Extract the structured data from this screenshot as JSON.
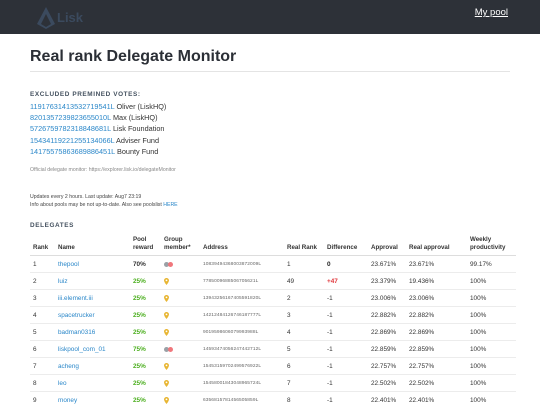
{
  "header": {
    "logo_text": "Lisk",
    "my_pool_link": "My pool"
  },
  "page": {
    "title": "Real rank Delegate Monitor"
  },
  "excluded": {
    "heading": "EXCLUDED PREMINED VOTES:",
    "rows": [
      {
        "address": "11917631413532719541L",
        "name": "Oliver (LiskHQ)"
      },
      {
        "address": "8201357239823655010L",
        "name": "Max (LiskHQ)"
      },
      {
        "address": "5726759782318848681L",
        "name": "Lisk Foundation"
      },
      {
        "address": "15434119221255134066L",
        "name": "Adviser Fund"
      },
      {
        "address": "14175575863689886451L",
        "name": "Bounty Fund"
      }
    ],
    "official_note": "Official delegate monitor: https://explorer.lisk.io/delegateMonitor"
  },
  "info": {
    "line1": "Updates every 2 hours. Last update: Aug7 23:19",
    "line2_prefix": "Info about pools may be not up-to-date. Also see poolslist ",
    "line2_link": "HERE"
  },
  "delegates": {
    "heading": "DELEGATES",
    "columns": {
      "rank": "Rank",
      "name": "Name",
      "pool_reward": "Pool reward",
      "group_member": "Group member*",
      "address": "Address",
      "real_rank": "Real Rank",
      "difference": "Difference",
      "approval": "Approval",
      "real_approval": "Real approval",
      "weekly_productivity": "Weekly productivity"
    },
    "rows": [
      {
        "rank": "1",
        "name": "thepool",
        "reward": "70%",
        "group": "gdt-elite",
        "address": "10839494368003872009L",
        "real_rank": "1",
        "difference": "0",
        "diff_type": "zero",
        "approval": "23.671%",
        "real_approval": "23.671%",
        "productivity": "99.17%"
      },
      {
        "rank": "2",
        "name": "luiz",
        "reward": "25%",
        "group": "pin",
        "address": "7785009688506705621L",
        "real_rank": "49",
        "difference": "+47",
        "diff_type": "pos",
        "approval": "23.379%",
        "real_approval": "19.436%",
        "productivity": "100%"
      },
      {
        "rank": "3",
        "name": "iii.element.iii",
        "reward": "25%",
        "group": "pin",
        "address": "13943256167405591820L",
        "real_rank": "2",
        "difference": "-1",
        "diff_type": "neg",
        "approval": "23.006%",
        "real_approval": "23.006%",
        "productivity": "100%"
      },
      {
        "rank": "4",
        "name": "spacetrucker",
        "reward": "25%",
        "group": "pin",
        "address": "14212484126746187777L",
        "real_rank": "3",
        "difference": "-1",
        "diff_type": "neg",
        "approval": "22.882%",
        "real_approval": "22.882%",
        "productivity": "100%"
      },
      {
        "rank": "5",
        "name": "badman0316",
        "reward": "25%",
        "group": "pin",
        "address": "9019598606079993988L",
        "real_rank": "4",
        "difference": "-1",
        "diff_type": "neg",
        "approval": "22.869%",
        "real_approval": "22.869%",
        "productivity": "100%"
      },
      {
        "rank": "6",
        "name": "liskpool_com_01",
        "reward": "75%",
        "group": "gdt-elite",
        "address": "14593474056247442712L",
        "real_rank": "5",
        "difference": "-1",
        "diff_type": "neg",
        "approval": "22.859%",
        "real_approval": "22.859%",
        "productivity": "100%"
      },
      {
        "rank": "7",
        "name": "acheng",
        "reward": "25%",
        "group": "pin",
        "address": "15453159702499576922L",
        "real_rank": "6",
        "difference": "-1",
        "diff_type": "neg",
        "approval": "22.757%",
        "real_approval": "22.757%",
        "productivity": "100%"
      },
      {
        "rank": "8",
        "name": "leo",
        "reward": "25%",
        "group": "pin",
        "address": "15458001843048965724L",
        "real_rank": "7",
        "difference": "-1",
        "diff_type": "neg",
        "approval": "22.502%",
        "real_approval": "22.502%",
        "productivity": "100%"
      },
      {
        "rank": "9",
        "name": "money",
        "reward": "25%",
        "group": "pin",
        "address": "6356815781456505859L",
        "real_rank": "8",
        "difference": "-1",
        "diff_type": "neg",
        "approval": "22.401%",
        "real_approval": "22.401%",
        "productivity": "100%"
      }
    ]
  },
  "colors": {
    "topbar": "#2d3138",
    "link": "#2a87c9",
    "reward_green": "#4caf1f",
    "diff_positive": "#e0363b",
    "pin_yellow": "#e8b634"
  }
}
